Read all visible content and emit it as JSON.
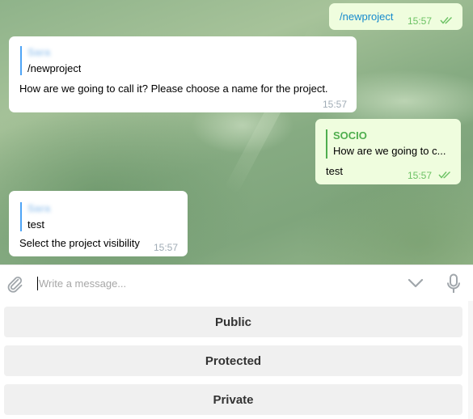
{
  "messages": [
    {
      "direction": "outgoing",
      "text": "/newproject",
      "time": "15:57",
      "status": "read"
    },
    {
      "direction": "incoming",
      "reply_author": "Sara",
      "reply_snippet": "/newproject",
      "text": "How are we going to call it? Please choose a name for the project.",
      "time": "15:57"
    },
    {
      "direction": "outgoing",
      "reply_author": "SOCIO",
      "reply_snippet": "How are we going to c...",
      "text": "test",
      "time": "15:57",
      "status": "read"
    },
    {
      "direction": "incoming",
      "reply_author": "Sara",
      "reply_snippet": "test",
      "text": "Select the project visibility",
      "time": "15:57"
    }
  ],
  "composer": {
    "placeholder": "Write a message..."
  },
  "keyboard": {
    "buttons": [
      "Public",
      "Protected",
      "Private"
    ]
  },
  "colors": {
    "outgoing_bubble": "#effdde",
    "incoming_bubble": "#ffffff",
    "link_blue": "#168acd",
    "reply_bar_blue": "#4ea4f6",
    "reply_bar_green": "#4fae4e",
    "read_check_green": "#6cc264"
  },
  "icons": [
    "attach-icon",
    "chevron-down-icon",
    "microphone-icon",
    "double-check-icon"
  ]
}
